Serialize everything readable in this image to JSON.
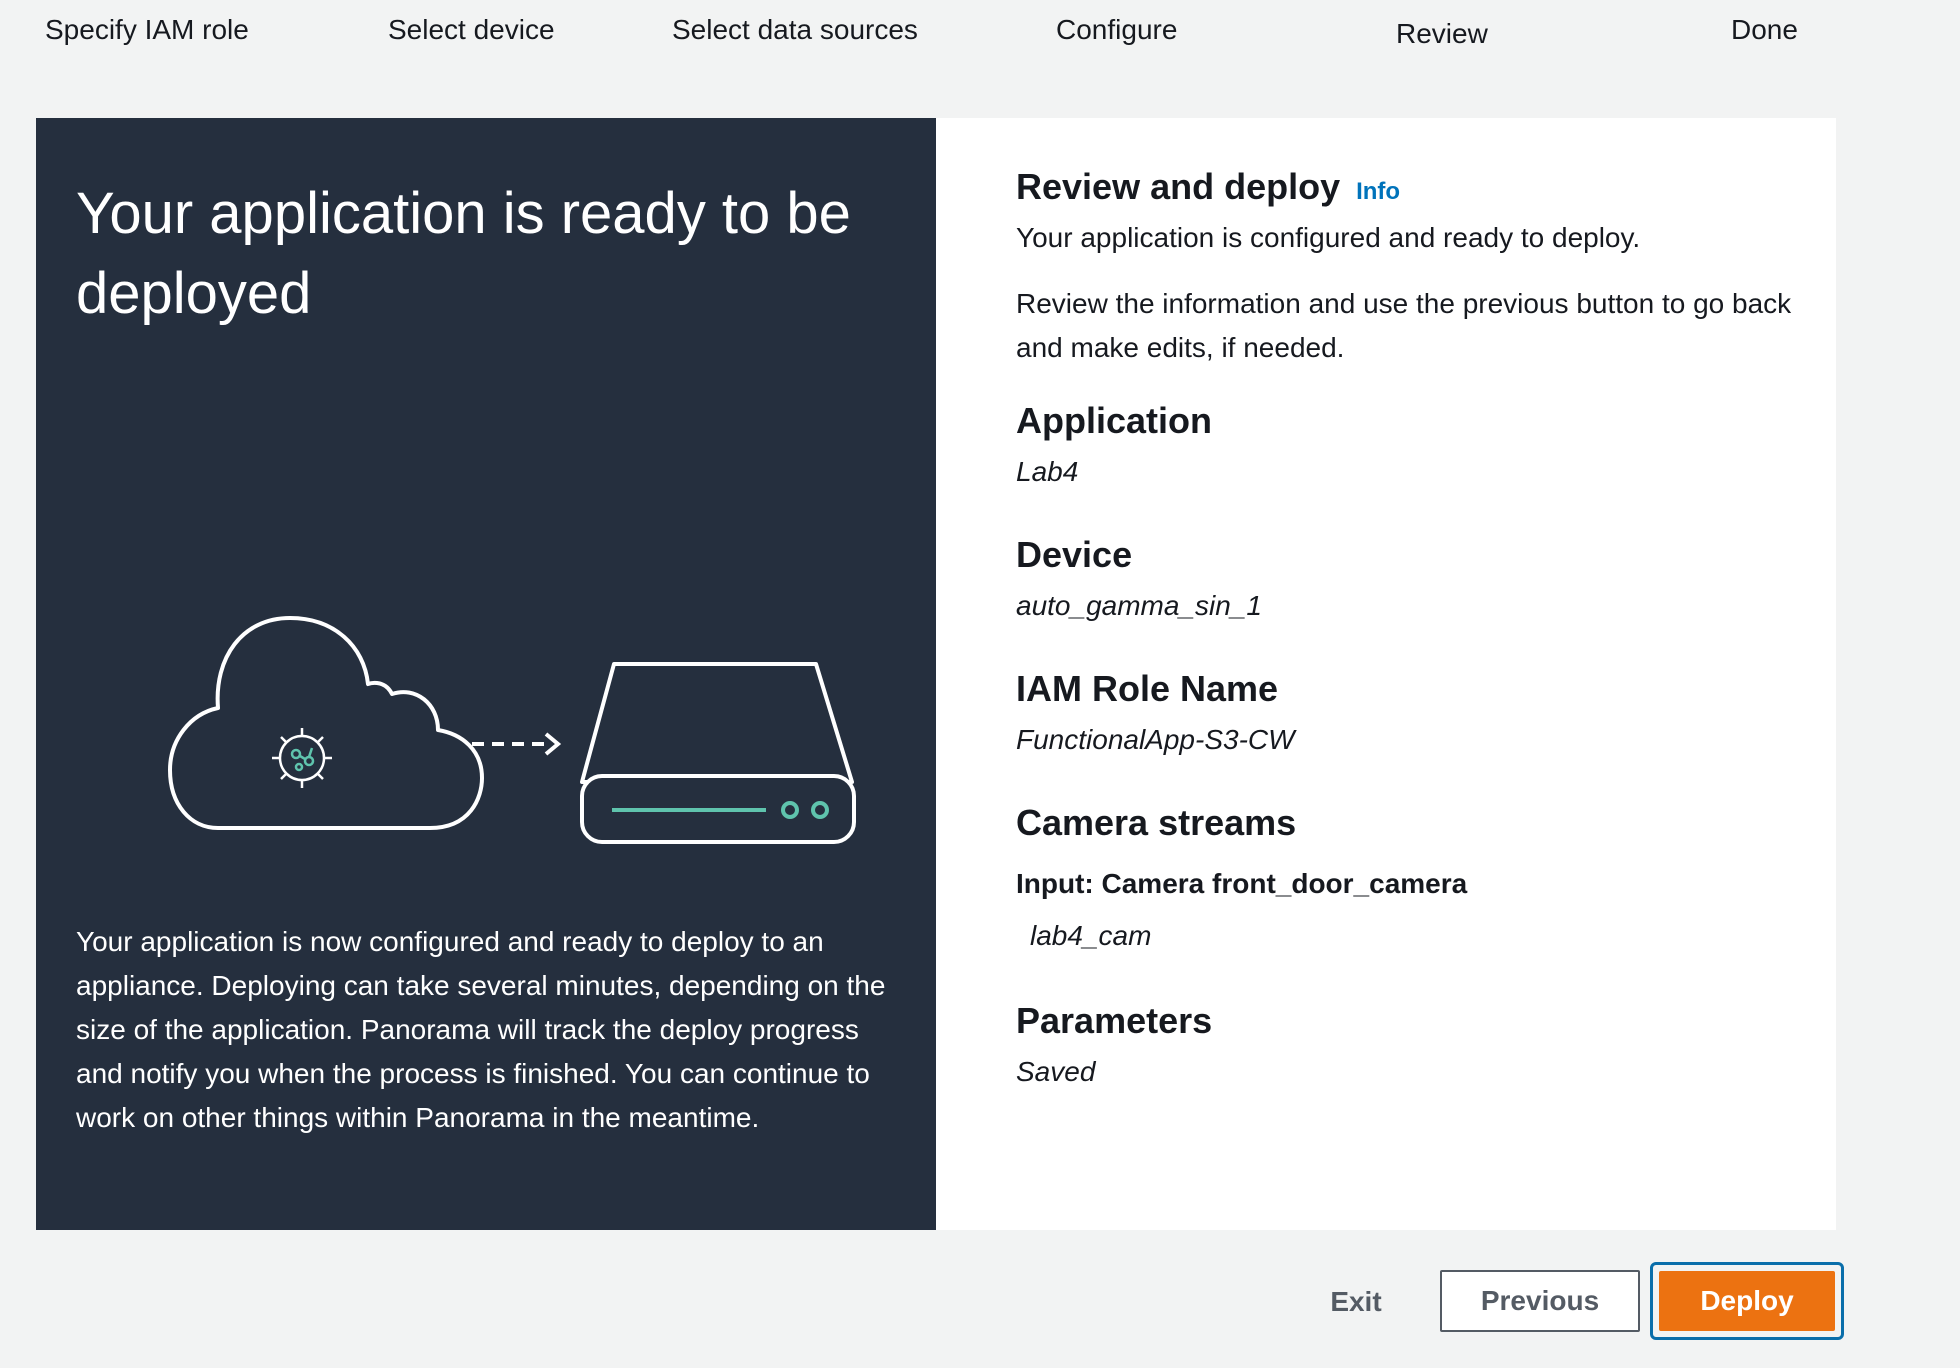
{
  "wizard": {
    "steps": [
      {
        "label": "Specify IAM role"
      },
      {
        "label": "Select device"
      },
      {
        "label": "Select data sources"
      },
      {
        "label": "Configure"
      },
      {
        "label": "Review"
      },
      {
        "label": "Done"
      }
    ],
    "current_step": "Review"
  },
  "hero": {
    "title": "Your application is ready to be deployed",
    "description": "Your application is now configured and ready to deploy to an appliance. Deploying can take several minutes, depending on the size of the application. Panorama will track the deploy progress and notify you when the process is finished. You can continue to work on other things within Panorama in the meantime.",
    "illustration_icons": [
      "cloud-icon",
      "gear-icon",
      "dashed-arrow-icon",
      "appliance-icon"
    ]
  },
  "review": {
    "title": "Review and deploy",
    "info_label": "Info",
    "subtitle": "Your application is configured and ready to deploy.",
    "note": "Review the information and use the previous button to go back and make edits, if needed.",
    "application": {
      "heading": "Application",
      "value": "Lab4"
    },
    "device": {
      "heading": "Device",
      "value": "auto_gamma_sin_1"
    },
    "iam_role": {
      "heading": "IAM Role Name",
      "value": "FunctionalApp-S3-CW"
    },
    "camera_streams": {
      "heading": "Camera streams",
      "input_label": "Input: Camera front_door_camera",
      "value": "lab4_cam"
    },
    "parameters": {
      "heading": "Parameters",
      "value": "Saved"
    }
  },
  "footer": {
    "exit_label": "Exit",
    "previous_label": "Previous",
    "deploy_label": "Deploy"
  },
  "colors": {
    "page_bg": "#f2f3f3",
    "hero_bg": "#252f3e",
    "accent_teal": "#5fc4ad",
    "link_blue": "#0073bb",
    "deploy_orange": "#ec7211",
    "focus_ring": "#0a6eaa"
  }
}
